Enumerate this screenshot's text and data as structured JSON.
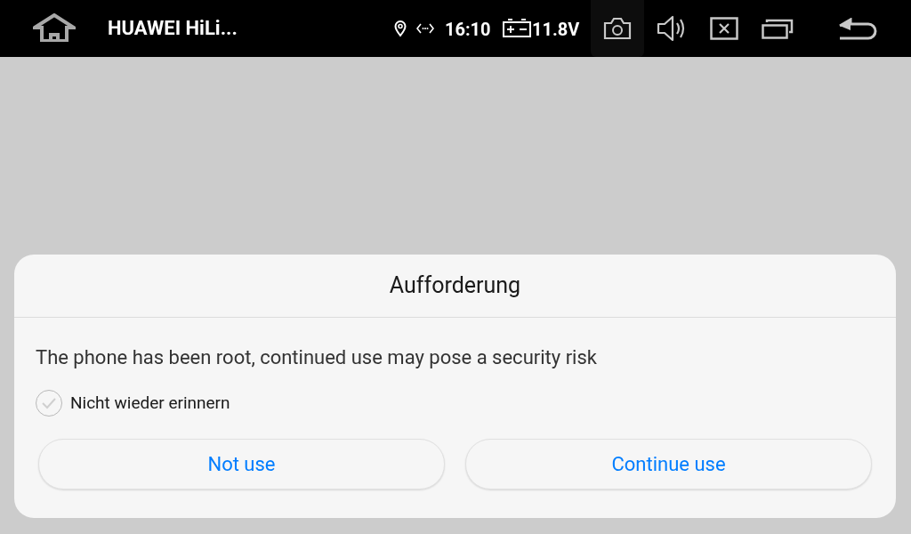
{
  "status_bar": {
    "app_title": "HUAWEI HiLi...",
    "time": "16:10",
    "voltage": "11.8V"
  },
  "dialog": {
    "title": "Aufforderung",
    "message": "The phone has been root, continued use may pose a security risk",
    "checkbox": {
      "label": "Nicht wieder erinnern",
      "checked": false
    },
    "buttons": [
      {
        "label": "Not use"
      },
      {
        "label": "Continue use"
      }
    ]
  }
}
